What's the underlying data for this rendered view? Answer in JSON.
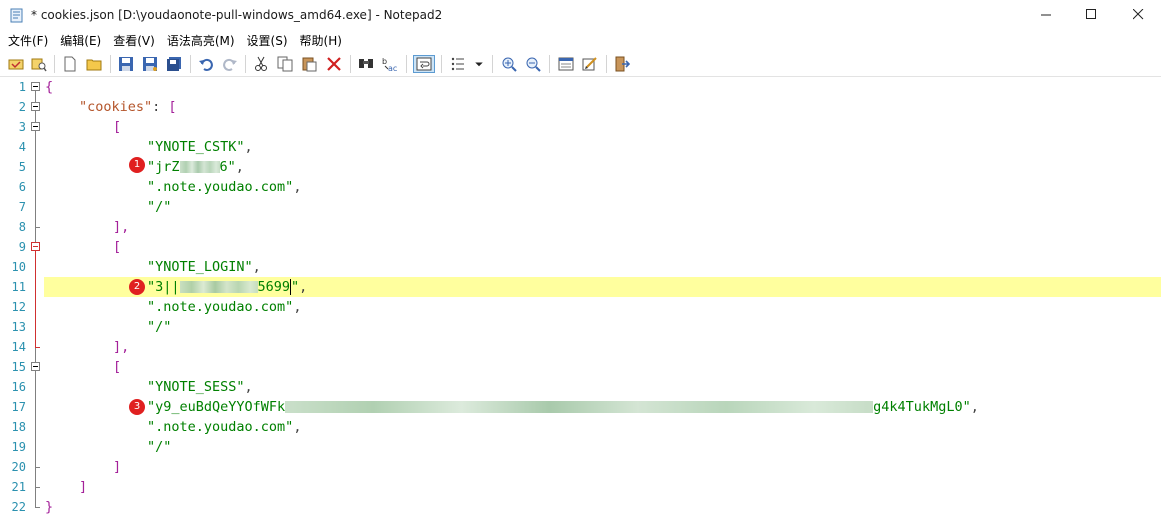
{
  "window": {
    "title": "* cookies.json [D:\\youdaonote-pull-windows_amd64.exe] - Notepad2",
    "min_symbol": "—",
    "max_symbol": "☐",
    "close_symbol": "✕"
  },
  "menu": [
    {
      "label": "文件(F)"
    },
    {
      "label": "编辑(E)"
    },
    {
      "label": "查看(V)"
    },
    {
      "label": "语法高亮(M)"
    },
    {
      "label": "设置(S)"
    },
    {
      "label": "帮助(H)"
    }
  ],
  "toolbar": {
    "icons": [
      "open-recent-icon",
      "find-file-icon",
      "new-file-icon",
      "open-folder-icon",
      "save-icon",
      "save-as-icon",
      "save-copy-icon",
      "undo-icon",
      "redo-icon",
      "cut-icon",
      "copy-icon",
      "paste-icon",
      "delete-icon",
      "find-icon",
      "replace-icon",
      "word-wrap-icon",
      "bookmarks-icon",
      "dropdown-arrow-icon",
      "zoom-in-icon",
      "zoom-out-icon",
      "scheme-icon",
      "customize-icon",
      "exit-icon"
    ]
  },
  "editor": {
    "line_numbers": [
      "1",
      "2",
      "3",
      "4",
      "5",
      "6",
      "7",
      "8",
      "9",
      "10",
      "11",
      "12",
      "13",
      "14",
      "15",
      "16",
      "17",
      "18",
      "19",
      "20",
      "21",
      "22"
    ],
    "current_line": "11",
    "lines": {
      "l1": "{",
      "l2_key": "\"cookies\"",
      "l2_colon": ": ",
      "l2_bracket": "[",
      "l3": "[",
      "l4": "\"YNOTE_CSTK\"",
      "l4_comma": ",",
      "l5_a": "\"jrZ",
      "l5_b": "6\"",
      "l5_comma": ",",
      "l6": "\".note.youdao.com\"",
      "l6_comma": ",",
      "l7": "\"/\"",
      "l8": "],",
      "l9": "[",
      "l10": "\"YNOTE_LOGIN\"",
      "l10_comma": ",",
      "l11_a": "\"3||",
      "l11_b": "5699",
      "l11_c": "\"",
      "l11_comma": ",",
      "l12": "\".note.youdao.com\"",
      "l12_comma": ",",
      "l13": "\"/\"",
      "l14": "],",
      "l15": "[",
      "l16": "\"YNOTE_SESS\"",
      "l16_comma": ",",
      "l17_a": "\"y9_euBdQeYYOfWFk",
      "l17_b": "g4k4TukMgL0\"",
      "l17_comma": ",",
      "l18": "\".note.youdao.com\"",
      "l18_comma": ",",
      "l19": "\"/\"",
      "l20": "]",
      "l21": "]",
      "l22": "}"
    },
    "annotations": [
      "1",
      "2",
      "3"
    ]
  },
  "colors": {
    "key": "#b4552b",
    "string": "#008000",
    "bracket": "#a4219a",
    "line_number": "#2b91af",
    "current_line": "#ffff9e",
    "badge": "#e02020"
  }
}
